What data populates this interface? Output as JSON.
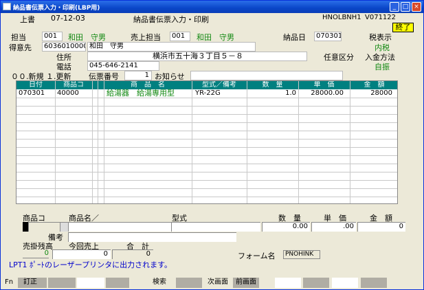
{
  "window": {
    "title": "納品書伝票入力・印刷(LBP用)"
  },
  "header": {
    "mode": "上書",
    "date": "07-12-03",
    "screen_title": "納品書伝票入力・印刷",
    "program_id": "HNOLBNH1",
    "version": "V071122",
    "end_button": "終了"
  },
  "form": {
    "tanto_label": "担当",
    "tanto_code": "001",
    "tanto_name": "和田　守男",
    "uriage_tanto_label": "売上担当",
    "uriage_tanto_code": "001",
    "uriage_tanto_name": "和田　守男",
    "nohinbi_label": "納品日",
    "nohinbi": "070301",
    "zei_label": "税表示",
    "zei_value": "内税",
    "tokuisaki_label": "得意先",
    "tokuisaki_code": "6036010000",
    "tokuisaki_name": "和田　守男",
    "jusho_label": "住所",
    "jusho": "横浜市五十海３丁目５－８",
    "nini_label": "任意区分",
    "nyukin_label": "入金方法",
    "nyukin_value": "自振",
    "denwa_label": "電話",
    "denwa": "045-646-2141",
    "mode_options": "００.新規 １.更新",
    "denpyo_label": "伝票番号",
    "denpyo_no": "1",
    "oshirase_label": "お知らせ"
  },
  "grid": {
    "columns": [
      "日付",
      "商品コ",
      "商　品　名",
      "型式／備考",
      "数　量",
      "単　価",
      "金　額"
    ],
    "rows": [
      {
        "date": "070301",
        "code": "40000",
        "name": "給湯器　給湯専用型",
        "model": "YR-22G",
        "qty": "1.0",
        "price": "28000.00",
        "amount": "28000"
      }
    ]
  },
  "entry": {
    "code_label": "商品コ",
    "name_label": "商品名／",
    "model_label": "型式",
    "qty_label": "数　量",
    "price_label": "単　価",
    "amount_label": "金　額",
    "qty": "0.00",
    "price": ".00",
    "amount": "0",
    "biko_label": "備考",
    "urikake_label": "売掛残高",
    "konkai_label": "今回売上",
    "gokei_label": "合　計",
    "urikake": "0",
    "konkai": "0",
    "gokei": "0",
    "form_label": "フォーム名",
    "form_name": "PNOHINK"
  },
  "status": {
    "message": "LPT1 ﾎﾟｰﾄのレーザープリンタに出力されます。"
  },
  "fkeys": {
    "fn": "Fn",
    "teisei": "訂正",
    "kensaku": "検索",
    "next": "次画面",
    "prev": "前画面"
  },
  "colors": {
    "title_bar": "#0a46c8",
    "grid_header": "#008080",
    "accent_green": "#118811",
    "end_button": "#ffff00"
  }
}
